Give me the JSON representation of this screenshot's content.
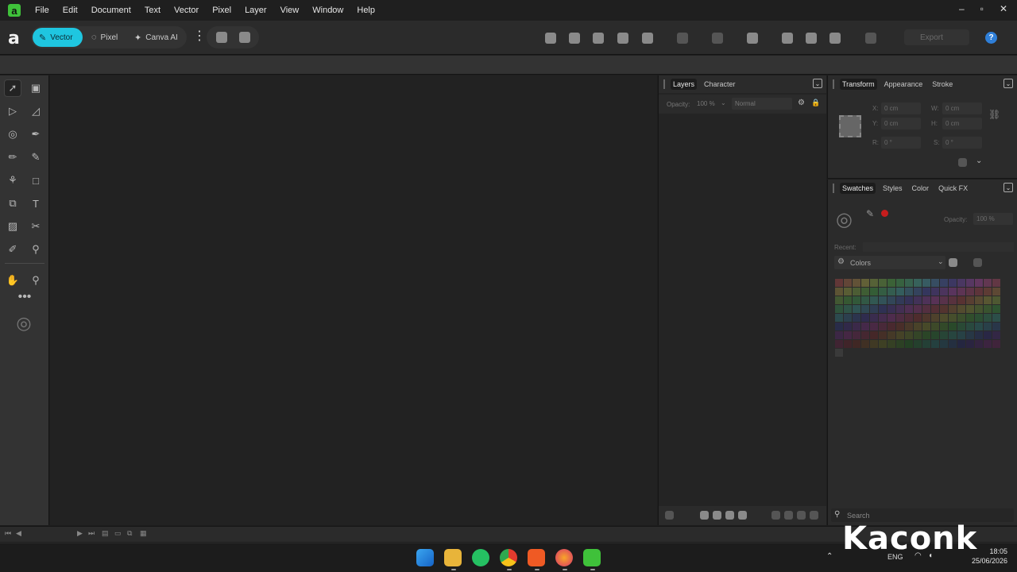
{
  "menubar": {
    "items": [
      "File",
      "Edit",
      "Document",
      "Text",
      "Vector",
      "Pixel",
      "Layer",
      "View",
      "Window",
      "Help"
    ],
    "window_controls": [
      "–",
      "▫",
      "✕"
    ]
  },
  "toolbar": {
    "brand_glyph": "a",
    "personas": [
      "Vector",
      "Pixel",
      "Canva AI"
    ],
    "active_persona": "Vector",
    "export_label": "Export",
    "help_label": "?"
  },
  "layers_panel": {
    "tabs": [
      "Layers",
      "Character"
    ],
    "active_tab": "Layers",
    "opacity_label": "Opacity:",
    "opacity_value": "100 %",
    "blend_mode": "Normal"
  },
  "transform_panel": {
    "tabs": [
      "Transform",
      "Appearance",
      "Stroke"
    ],
    "active_tab": "Transform",
    "x_label": "X:",
    "x_value": "0 cm",
    "y_label": "Y:",
    "y_value": "0 cm",
    "w_label": "W:",
    "w_value": "0 cm",
    "h_label": "H:",
    "h_value": "0 cm",
    "r_label": "R:",
    "r_value": "0 °",
    "s_label": "S:",
    "s_value": "0 °"
  },
  "swatches_panel": {
    "tabs": [
      "Swatches",
      "Styles",
      "Color",
      "Quick FX"
    ],
    "active_tab": "Swatches",
    "opacity_label": "Opacity:",
    "opacity_value": "100 %",
    "recent_label": "Recent:",
    "palette_name": "Colors",
    "search_placeholder": "Search"
  },
  "taskbar": {
    "language": "ENG",
    "time": "18:05",
    "date": "25/06/2026"
  },
  "watermark": "Kaconk",
  "colors": {
    "accent": "#1fc6e0",
    "app_green": "#3fc13a",
    "canvas": "#222222",
    "panel": "#2b2b2b"
  }
}
